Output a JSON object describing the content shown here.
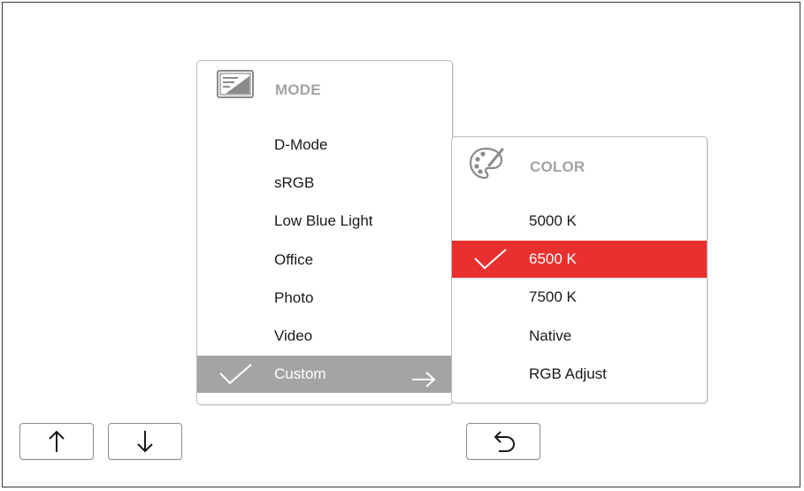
{
  "mode_menu": {
    "title": "MODE",
    "icon": "mode-icon",
    "items": [
      {
        "label": "D-Mode"
      },
      {
        "label": "sRGB"
      },
      {
        "label": "Low Blue Light"
      },
      {
        "label": "Office"
      },
      {
        "label": "Photo"
      },
      {
        "label": "Video"
      },
      {
        "label": "Custom",
        "selected": true,
        "has_submenu": true
      }
    ]
  },
  "color_menu": {
    "title": "COLOR",
    "icon": "palette-icon",
    "items": [
      {
        "label": "5000 K"
      },
      {
        "label": "6500 K",
        "selected": true
      },
      {
        "label": "7500 K"
      },
      {
        "label": "Native"
      },
      {
        "label": "RGB Adjust"
      }
    ]
  },
  "buttons": {
    "up": "up-arrow-icon",
    "down": "down-arrow-icon",
    "back": "back-arrow-icon"
  },
  "colors": {
    "highlight_red": "#e8312f",
    "highlight_grey": "#a4a4a4",
    "header_text": "#a3a3a3"
  }
}
